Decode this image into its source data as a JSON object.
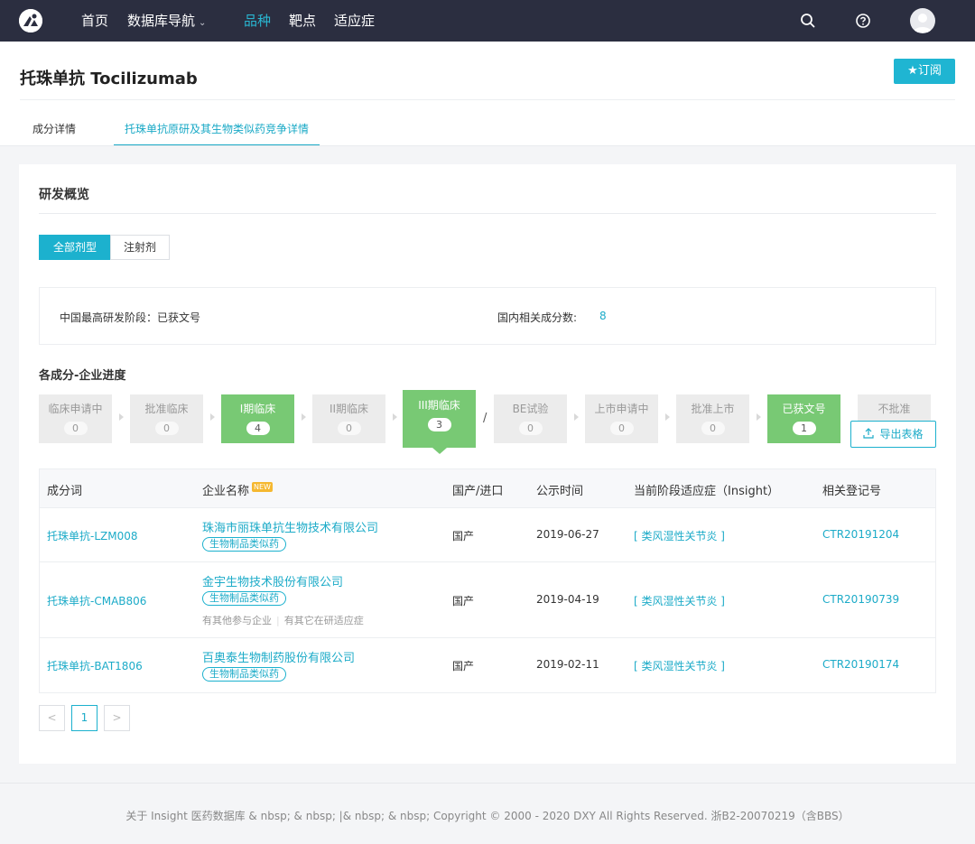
{
  "nav": {
    "items": [
      {
        "label": "首页"
      },
      {
        "label": "数据库导航"
      },
      {
        "label": "品种"
      },
      {
        "label": "靶点"
      },
      {
        "label": "适应症"
      }
    ],
    "dropdown_icon": "chevron-down-icon",
    "active_item": "品种",
    "icons": [
      "search-icon",
      "help-icon",
      "avatar"
    ],
    "bg_color": "#2b2e40",
    "active_color": "#29b6d1"
  },
  "header": {
    "title": "托珠单抗 Tocilizumab",
    "subscribe_label": "★订阅"
  },
  "tabs": [
    {
      "label": "成分详情"
    },
    {
      "label": "托珠单抗原研及其生物类似药竞争详情"
    }
  ],
  "overview": {
    "title": "研发概览",
    "filters": [
      {
        "label": "全部剂型"
      },
      {
        "label": "注射剂"
      }
    ],
    "info": {
      "stage_label": "中国最高研发阶段：",
      "stage_value": "已获文号",
      "count_label": "国内相关成分数:",
      "count_value": "8"
    }
  },
  "progress": {
    "title": "各成分-企业进度",
    "stages": [
      {
        "label": "临床申请中",
        "count": "0"
      },
      {
        "label": "批准临床",
        "count": "0"
      },
      {
        "label": "I期临床",
        "count": "4"
      },
      {
        "label": "II期临床",
        "count": "0"
      },
      {
        "label": "III期临床",
        "count": "3"
      },
      {
        "label": "BE试验",
        "count": "0"
      },
      {
        "label": "上市申请中",
        "count": "0"
      },
      {
        "label": "批准上市",
        "count": "0"
      },
      {
        "label": "已获文号",
        "count": "1"
      },
      {
        "label": "不批准",
        "count": ""
      }
    ],
    "separator": "/",
    "export_label": "导出表格",
    "active_color": "#78c974"
  },
  "table": {
    "columns": [
      "成分词",
      "企业名称",
      "国产/进口",
      "公示时间",
      "当前阶段适应症（Insight）",
      "相关登记号"
    ],
    "new_badge": "NEW",
    "rows": [
      {
        "ingredient": "托珠单抗-LZM008",
        "company": "珠海市丽珠单抗生物技术有限公司",
        "tag": "生物制品类似药",
        "origin": "国产",
        "date": "2019-06-27",
        "indication": "[ 类风湿性关节炎 ]",
        "reg_no": "CTR20191204"
      },
      {
        "ingredient": "托珠单抗-CMAB806",
        "company": "金宇生物技术股份有限公司",
        "tag": "生物制品类似药",
        "extra_1": "有其他参与企业",
        "extra_2": "有其它在研适应症",
        "origin": "国产",
        "date": "2019-04-19",
        "indication": "[ 类风湿性关节炎 ]",
        "reg_no": "CTR20190739"
      },
      {
        "ingredient": "托珠单抗-BAT1806",
        "company": "百奥泰生物制药股份有限公司",
        "tag": "生物制品类似药",
        "origin": "国产",
        "date": "2019-02-11",
        "indication": "[ 类风湿性关节炎 ]",
        "reg_no": "CTR20190174"
      }
    ]
  },
  "pagination": {
    "prev": "<",
    "current": "1",
    "next": ">"
  },
  "footer": {
    "text": "关于 Insight 医药数据库 & nbsp; & nbsp; |& nbsp; & nbsp; Copyright © 2000 - 2020 DXY All Rights Reserved. 浙B2-20070219（含BBS）"
  }
}
